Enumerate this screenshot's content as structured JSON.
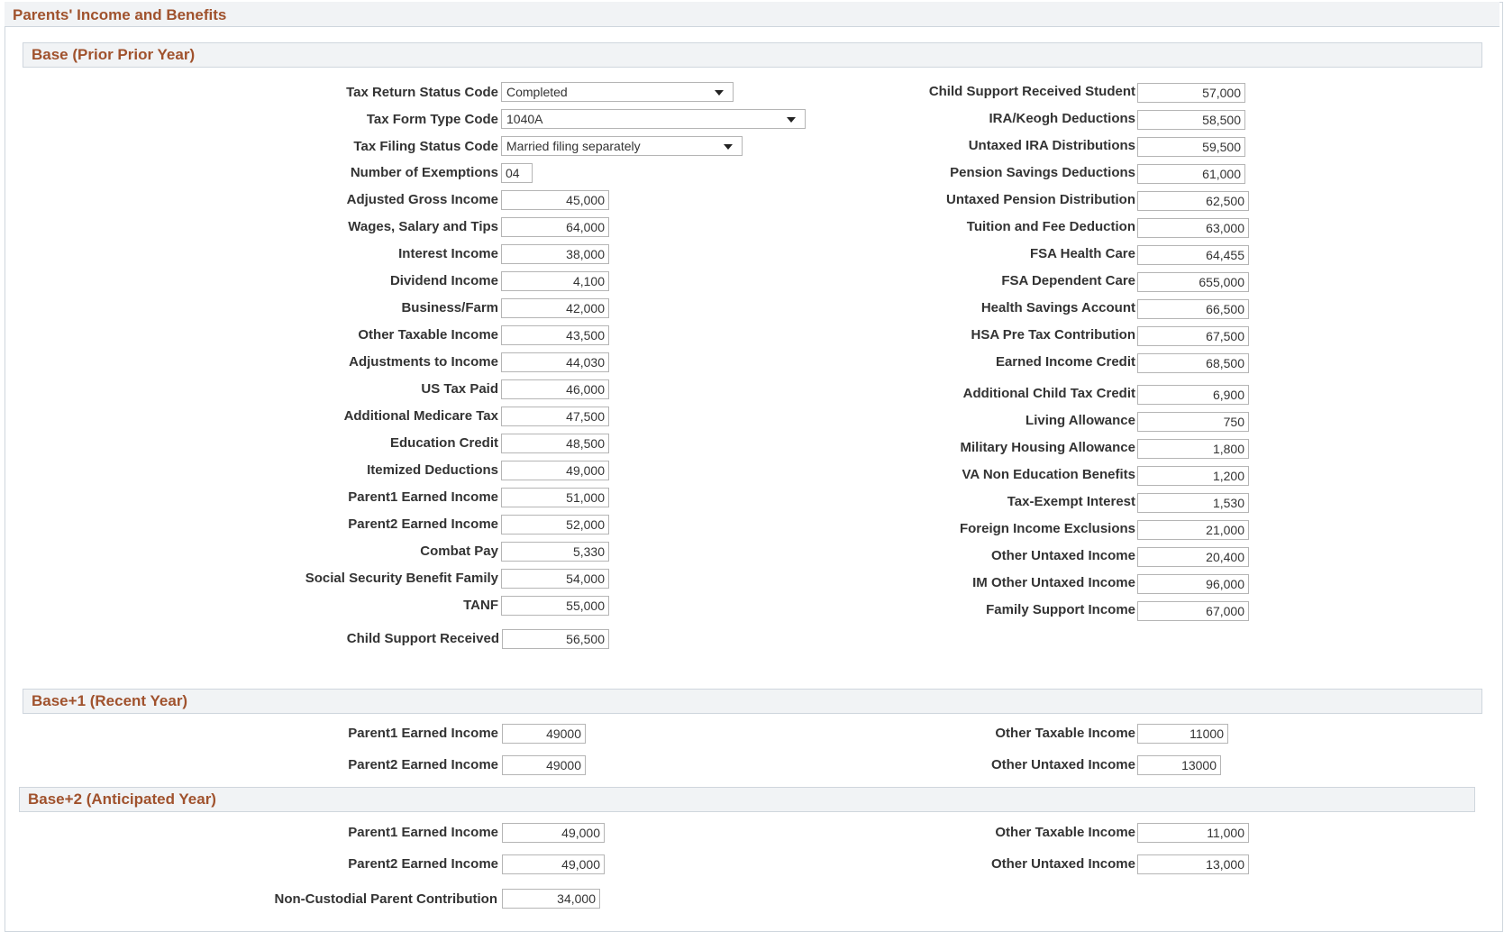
{
  "page": {
    "title": "Parents' Income and Benefits"
  },
  "sections": {
    "base": {
      "title": "Base (Prior Prior Year)"
    },
    "base1": {
      "title": "Base+1 (Recent Year)"
    },
    "base2": {
      "title": "Base+2 (Anticipated Year)"
    }
  },
  "base": {
    "tax_return_status": {
      "label": "Tax Return Status Code",
      "value": "Completed"
    },
    "tax_form_type": {
      "label": "Tax Form Type Code",
      "value": "1040A"
    },
    "tax_filing_status": {
      "label": "Tax Filing Status Code",
      "value": "Married filing separately"
    },
    "exemptions": {
      "label": "Number of Exemptions",
      "value": "04"
    },
    "left": [
      {
        "label": "Adjusted Gross Income",
        "value": "45,000"
      },
      {
        "label": "Wages, Salary and Tips",
        "value": "64,000"
      },
      {
        "label": "Interest Income",
        "value": "38,000"
      },
      {
        "label": "Dividend Income",
        "value": "4,100"
      },
      {
        "label": "Business/Farm",
        "value": "42,000"
      },
      {
        "label": "Other Taxable Income",
        "value": "43,500"
      },
      {
        "label": "Adjustments to Income",
        "value": "44,030"
      },
      {
        "label": "US Tax Paid",
        "value": "46,000"
      },
      {
        "label": "Additional Medicare Tax",
        "value": "47,500"
      },
      {
        "label": "Education Credit",
        "value": "48,500"
      },
      {
        "label": "Itemized Deductions",
        "value": "49,000"
      },
      {
        "label": "Parent1 Earned Income",
        "value": "51,000"
      },
      {
        "label": "Parent2 Earned Income",
        "value": "52,000"
      },
      {
        "label": "Combat Pay",
        "value": "5,330"
      },
      {
        "label": "Social Security Benefit Family",
        "value": "54,000"
      },
      {
        "label": "TANF",
        "value": "55,000"
      },
      {
        "label": "Child Support Received",
        "value": "56,500"
      }
    ],
    "right": [
      {
        "label": "Child Support Received Student",
        "value": "57,000"
      },
      {
        "label": "IRA/Keogh Deductions",
        "value": "58,500"
      },
      {
        "label": "Untaxed IRA Distributions",
        "value": "59,500"
      },
      {
        "label": "Pension Savings Deductions",
        "value": "61,000"
      },
      {
        "label": "Untaxed Pension Distribution",
        "value": "62,500"
      },
      {
        "label": "Tuition and Fee Deduction",
        "value": "63,000"
      },
      {
        "label": "FSA Health Care",
        "value": "64,455"
      },
      {
        "label": "FSA Dependent Care",
        "value": "655,000"
      },
      {
        "label": "Health Savings Account",
        "value": "66,500"
      },
      {
        "label": "HSA Pre Tax Contribution",
        "value": "67,500"
      },
      {
        "label": "Earned Income Credit",
        "value": "68,500"
      },
      {
        "label": "Additional Child Tax Credit",
        "value": "6,900"
      },
      {
        "label": "Living Allowance",
        "value": "750"
      },
      {
        "label": "Military Housing Allowance",
        "value": "1,800"
      },
      {
        "label": "VA Non Education Benefits",
        "value": "1,200"
      },
      {
        "label": "Tax-Exempt Interest",
        "value": "1,530"
      },
      {
        "label": "Foreign Income Exclusions",
        "value": "21,000"
      },
      {
        "label": "Other Untaxed Income",
        "value": "20,400"
      },
      {
        "label": "IM Other Untaxed Income",
        "value": "96,000"
      },
      {
        "label": "Family Support Income",
        "value": "67,000"
      }
    ]
  },
  "base1": {
    "left": [
      {
        "label": "Parent1 Earned Income",
        "value": "49000"
      },
      {
        "label": "Parent2 Earned Income",
        "value": "49000"
      }
    ],
    "right": [
      {
        "label": "Other Taxable Income",
        "value": "11000"
      },
      {
        "label": "Other Untaxed Income",
        "value": "13000"
      }
    ]
  },
  "base2": {
    "left": [
      {
        "label": "Parent1 Earned Income",
        "value": "49,000"
      },
      {
        "label": "Parent2 Earned Income",
        "value": "49,000"
      },
      {
        "label": "Non-Custodial Parent Contribution",
        "value": "34,000"
      }
    ],
    "right": [
      {
        "label": "Other Taxable Income",
        "value": "11,000"
      },
      {
        "label": "Other Untaxed Income",
        "value": "13,000"
      }
    ]
  }
}
